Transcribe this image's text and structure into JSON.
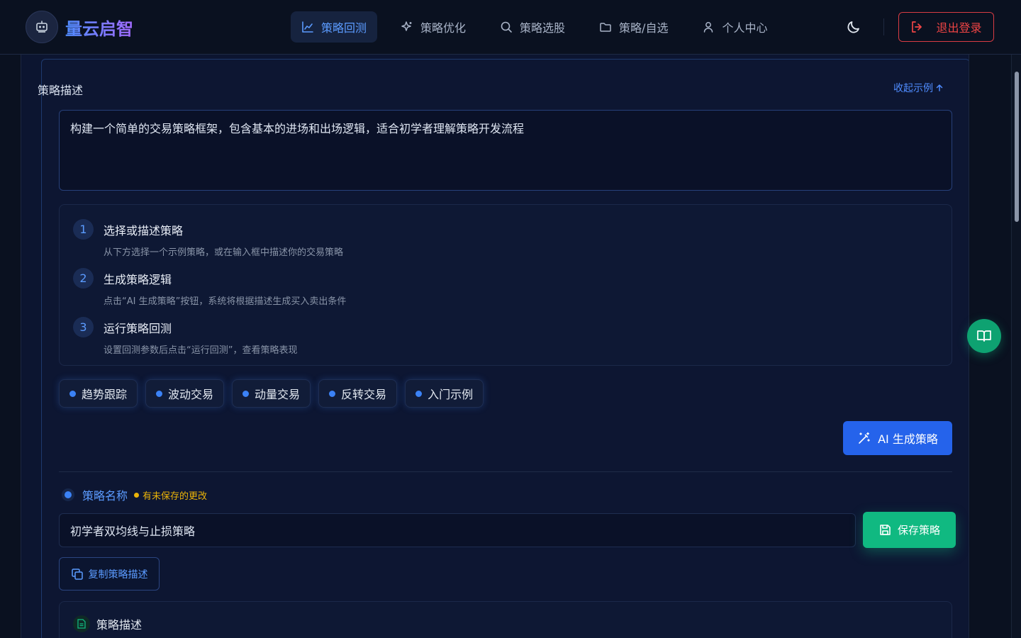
{
  "brand": {
    "name": "量云启智",
    "logo_icon": "robot-logo-icon"
  },
  "nav": {
    "items": [
      {
        "label": "策略回测",
        "icon": "line-chart-icon",
        "active": true
      },
      {
        "label": "策略优化",
        "icon": "sparkles-icon",
        "active": false
      },
      {
        "label": "策略选股",
        "icon": "search-icon",
        "active": false
      },
      {
        "label": "策略/自选",
        "icon": "folder-icon",
        "active": false
      },
      {
        "label": "个人中心",
        "icon": "user-icon",
        "active": false
      }
    ],
    "theme_icon": "moon-icon",
    "logout_label": "退出登录"
  },
  "strategy_desc": {
    "label": "策略描述",
    "collapse_label": "收起示例",
    "value": "构建一个简单的交易策略框架，包含基本的进场和出场逻辑，适合初学者理解策略开发流程"
  },
  "steps": [
    {
      "num": "1",
      "title": "选择或描述策略",
      "desc": "从下方选择一个示例策略，或在输入框中描述你的交易策略"
    },
    {
      "num": "2",
      "title": "生成策略逻辑",
      "desc": "点击“AI 生成策略”按钮，系统将根据描述生成买入卖出条件"
    },
    {
      "num": "3",
      "title": "运行策略回测",
      "desc": "设置回测参数后点击“运行回测”，查看策略表现"
    }
  ],
  "examples": [
    "趋势跟踪",
    "波动交易",
    "动量交易",
    "反转交易",
    "入门示例"
  ],
  "ai_button": "AI 生成策略",
  "strategy_name": {
    "label": "策略名称",
    "unsaved": "有未保存的更改",
    "value": "初学者双均线与止损策略",
    "save_label": "保存策略"
  },
  "copy_button": "复制策略描述",
  "bottom_section": {
    "label": "策略描述"
  },
  "colors": {
    "accent": "#3b82f6",
    "success": "#10b981",
    "danger": "#ef4444",
    "warning": "#eab308"
  }
}
